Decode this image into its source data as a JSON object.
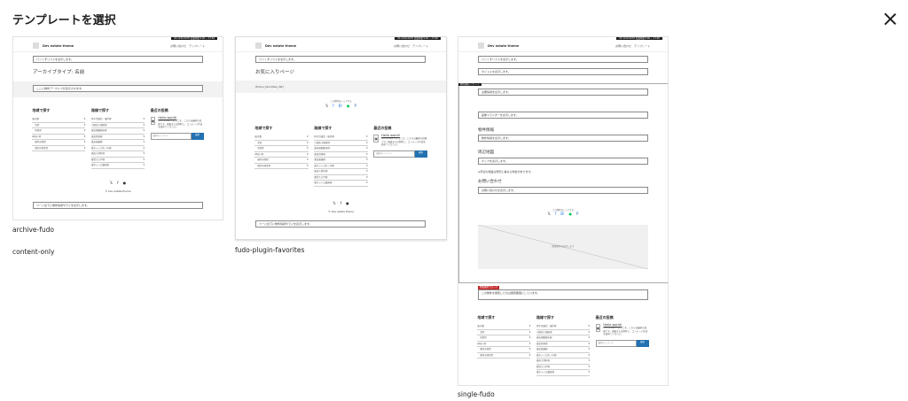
{
  "modal": {
    "title": "テンプレートを選択",
    "close_label": "×"
  },
  "common": {
    "top_contact": "03-1234-5678 営業時間 9:00 ~ 17:00",
    "site_name": "Dev estate theme",
    "nav_contact": "お問い合わせ",
    "nav_template": "テンプレート",
    "breadcrumb": "パンくずリストを表示します。",
    "widget_area_title": "地域で探す",
    "widget_line_title": "路線で探す",
    "widget_recent_title": "最近の投稿",
    "areas": [
      "東京都",
      "北区",
      "杉並区",
      "神奈川県",
      "横浜市西区",
      "横浜市港北区"
    ],
    "lines": [
      "JR京浜東北・根岸線",
      "小田急小田原線",
      "東急田園都市線",
      "東急目黒線",
      "東急東横線",
      "東京メトロ丸ノ内線",
      "東急大井町線",
      "都営大江戸線",
      "東京メトロ銀座線",
      "都営浅草線"
    ],
    "recent_post_title": "Hello world!",
    "recent_post_text": "WordPress へようこそ。こちらは最初の投稿です。編集または削除し、コンテンツ作成を始めてください。",
    "search_placeholder": "検索キーワード",
    "search_button": "検索",
    "copyright": "© Dev estate theme",
    "footer_box": "ページ全下に物件情報やライを表示します。",
    "share_label": "この物件をシェアする",
    "social": [
      "𝕏",
      "f",
      "B!",
      "●",
      "P"
    ]
  },
  "templates": [
    {
      "name": "archive-fudo",
      "heading": "アーカイブタイプ: 名前",
      "note": "ここに物件アーカイブが表示されます。"
    },
    {
      "name": "content-only"
    },
    {
      "name": "fudo-plugin-favorites",
      "heading": "お気に入りページ",
      "shortcode": "[fudou_favorites_list]"
    },
    {
      "name": "single-fudo",
      "title_box": "タイトルを表示します。",
      "dark_tag": "物件詳細テンプレート",
      "box1": "主要情報を表示します。",
      "box2": "画像スライダーを表示します。",
      "sec1": "物件情報",
      "box3": "物件情報を表示します。",
      "sec2": "周辺地図",
      "box4": "マップを表示します。",
      "note": "※周辺の施設は現況と異なる場合があります。",
      "sec3": "お問い合わせ",
      "box5": "お問い合わせを表示します。",
      "placeholder": "関連物件を表示します",
      "red_tag": "閲覧履歴ブロック",
      "box6": "この物件を閲覧したのは閲覧履歴にしています。"
    }
  ]
}
